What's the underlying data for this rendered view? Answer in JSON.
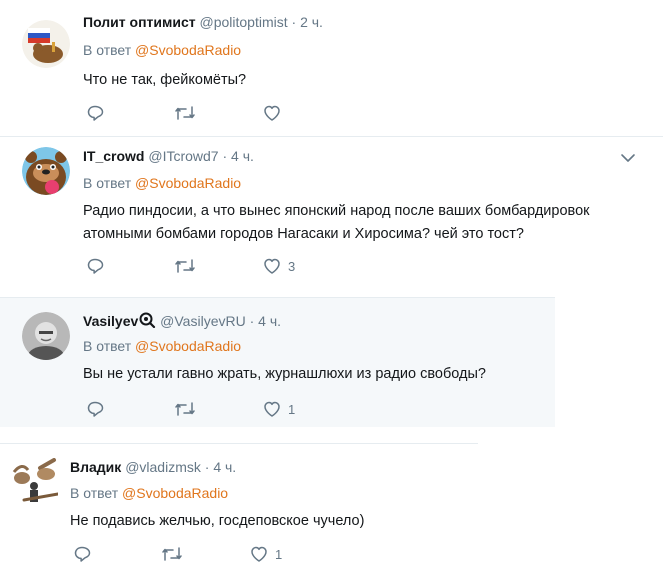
{
  "tweets": [
    {
      "name": "Полит оптимист",
      "handle": "@politoptimist",
      "time": "2 ч.",
      "reply_prefix": "В ответ",
      "reply_to": "@SvobodaRadio",
      "text": "Что не так, фейкомёты?",
      "likes": ""
    },
    {
      "name": "IT_crowd",
      "handle": "@ITcrowd7",
      "time": "4 ч.",
      "reply_prefix": "В ответ",
      "reply_to": "@SvobodaRadio",
      "text": "Радио пиндосии, а что вынес японский народ после ваших бомбардировок атомными бомбами городов Нагасаки и Хиросима? чей это тост?",
      "likes": "3"
    },
    {
      "name": "Vasilyev",
      "handle": "@VasilyevRU",
      "time": "4 ч.",
      "reply_prefix": "В ответ",
      "reply_to": "@SvobodaRadio",
      "text": "Вы не устали гавно жрать, журнашлюхи из радио свободы?",
      "likes": "1"
    },
    {
      "name": "Владик",
      "handle": "@vladizmsk",
      "time": "4 ч.",
      "reply_prefix": "В ответ",
      "reply_to": "@SvobodaRadio",
      "text": "Не подавись желчью, госдеповское чучело)",
      "likes": "1"
    }
  ],
  "separator": "·",
  "icons": {
    "reply": "reply-icon",
    "retweet": "retweet-icon",
    "like": "heart-icon",
    "menu": "chevron-down-icon",
    "badge": "eye-badge-icon"
  },
  "colors": {
    "link": "#e0761d",
    "muted": "#657786",
    "text": "#14171a",
    "divider": "#e6ecf0",
    "highlight": "#f5f8fa"
  }
}
